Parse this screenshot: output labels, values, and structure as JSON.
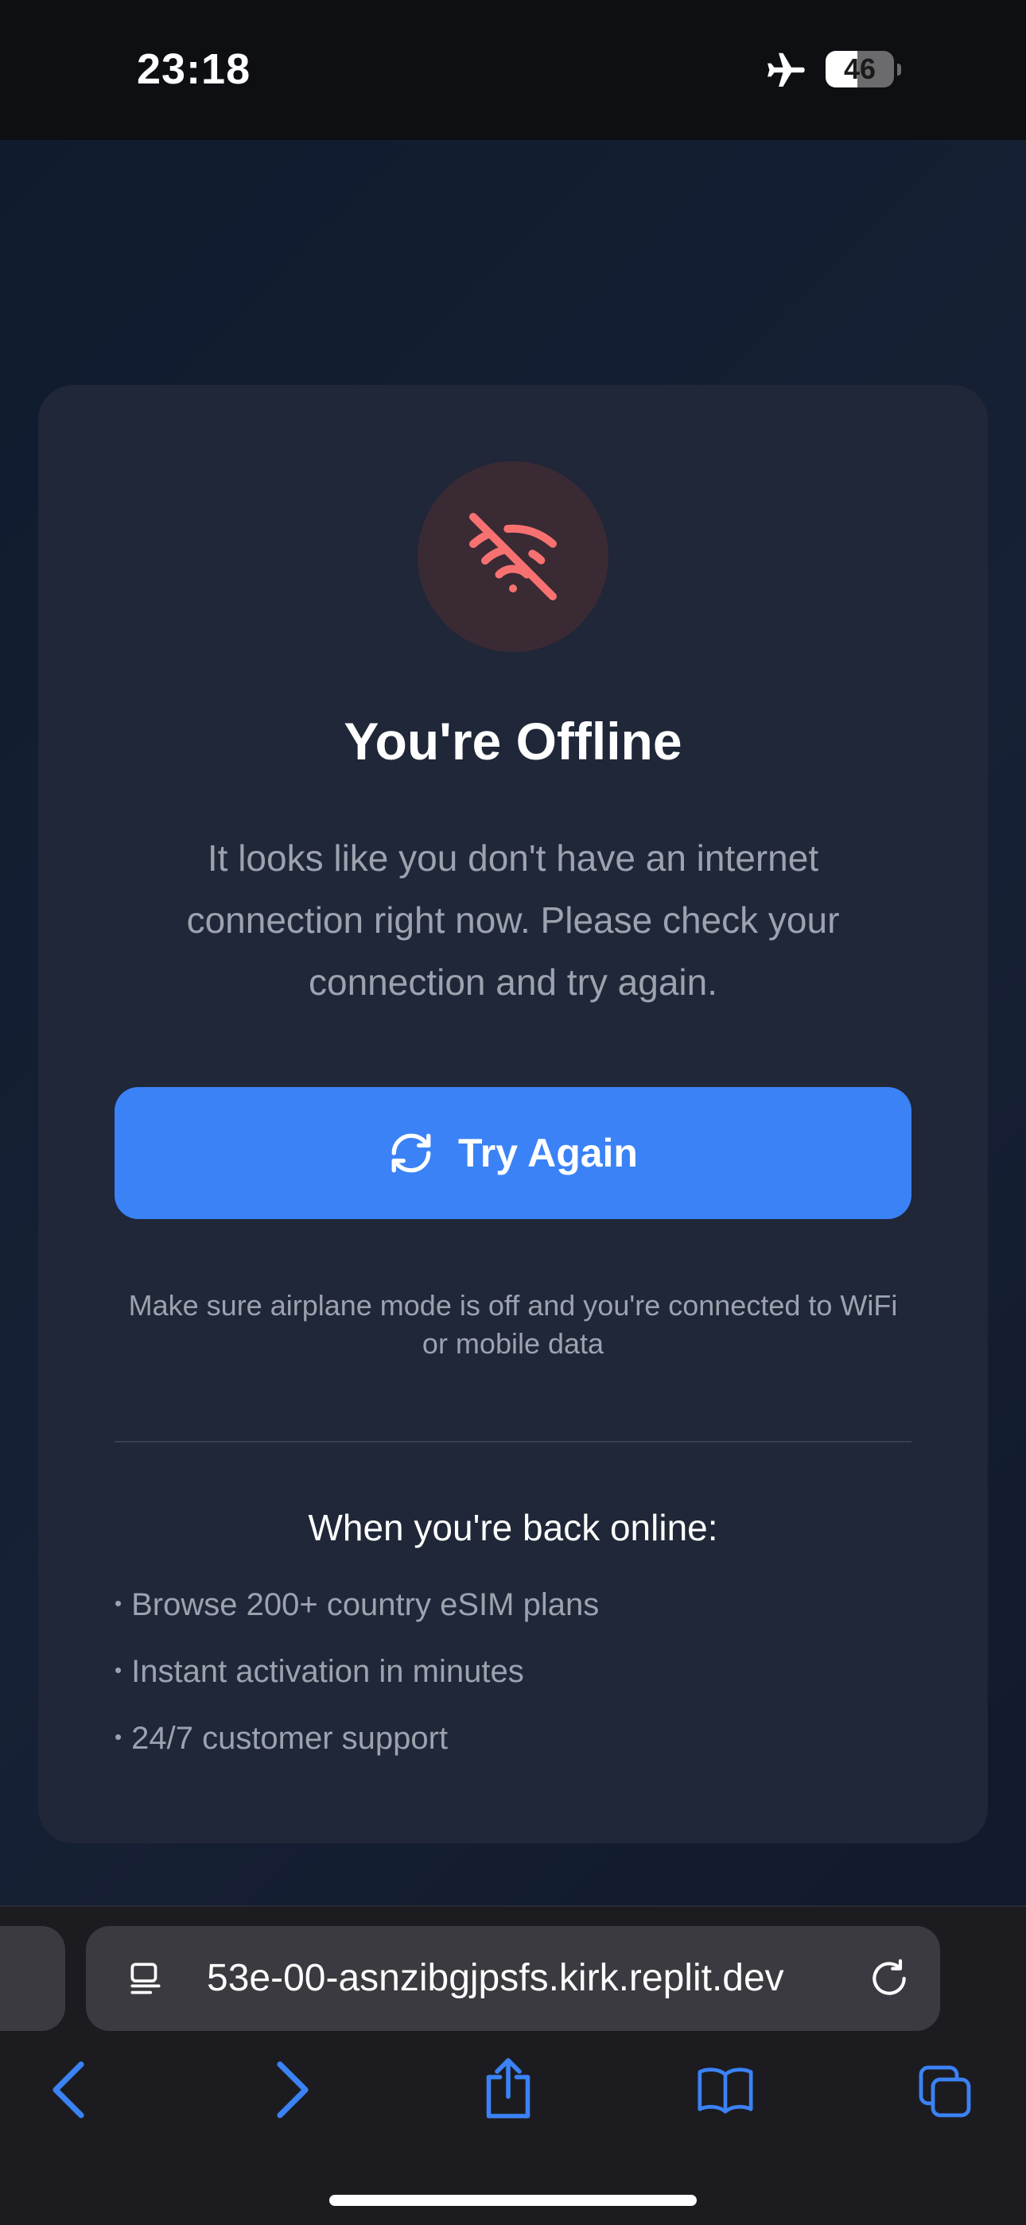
{
  "status_bar": {
    "time": "23:18",
    "battery_level": "46",
    "battery_fraction": 0.46,
    "airplane_icon": "airplane-icon"
  },
  "offline_card": {
    "icon": "wifi-off-icon",
    "title": "You're Offline",
    "message": "It looks like you don't have an internet connection right now. Please check your connection and try again.",
    "button_label": "Try Again",
    "button_icon": "refresh-icon",
    "hint": "Make sure airplane mode is off and you're connected to WiFi or mobile data",
    "back_online_heading": "When you're back online:",
    "benefits": [
      "Browse 200+ country eSIM plans",
      "Instant activation in minutes",
      "24/7 customer support"
    ]
  },
  "browser": {
    "address": "53e-00-asnzibgjpsfs.kirk.replit.dev",
    "icons": [
      "reader-icon",
      "reload-icon",
      "back-icon",
      "forward-icon",
      "share-icon",
      "bookmarks-icon",
      "tabs-icon"
    ]
  },
  "colors": {
    "accent": "#3b82f6",
    "error": "#f87171",
    "card": "#1f2738",
    "background": "#111b2e"
  }
}
